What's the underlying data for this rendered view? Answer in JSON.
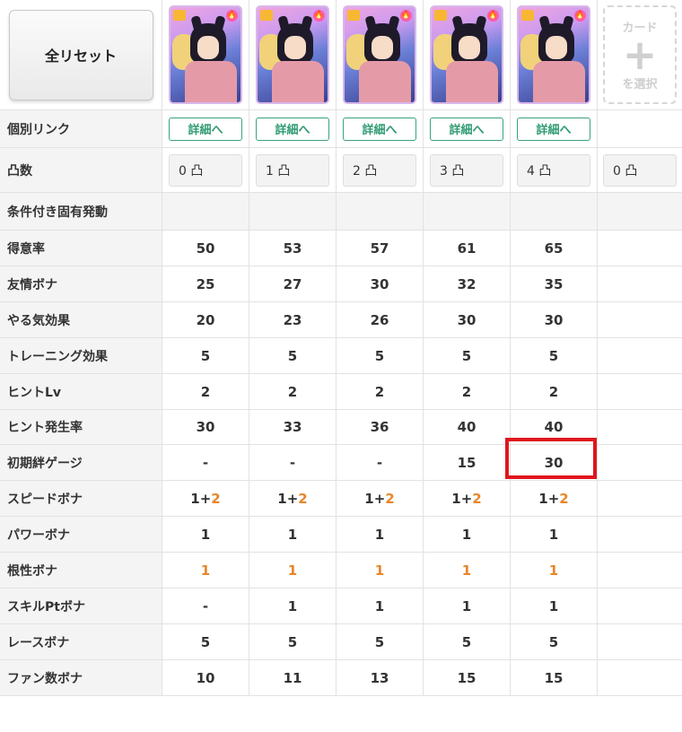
{
  "reset_button": "全リセット",
  "add_card": {
    "line1": "カード",
    "plus": "+",
    "line2": "を選択"
  },
  "cards": [
    {
      "flame": "🔥"
    },
    {
      "flame": "🔥"
    },
    {
      "flame": "🔥"
    },
    {
      "flame": "🔥"
    },
    {
      "flame": "🔥"
    }
  ],
  "rows": {
    "link": {
      "label": "個別リンク",
      "buttons": [
        "詳細へ",
        "詳細へ",
        "詳細へ",
        "詳細へ",
        "詳細へ"
      ]
    },
    "totsu": {
      "label": "凸数",
      "values": [
        "0 凸",
        "1 凸",
        "2 凸",
        "3 凸",
        "4 凸",
        "0 凸"
      ]
    },
    "conditional": {
      "label": "条件付き固有発動"
    },
    "tokui": {
      "label": "得意率",
      "values": [
        "50",
        "53",
        "57",
        "61",
        "65"
      ]
    },
    "yujo": {
      "label": "友情ボナ",
      "values": [
        "25",
        "27",
        "30",
        "32",
        "35"
      ]
    },
    "yaruki": {
      "label": "やる気効果",
      "values": [
        "20",
        "23",
        "26",
        "30",
        "30"
      ]
    },
    "training": {
      "label": "トレーニング効果",
      "values": [
        "5",
        "5",
        "5",
        "5",
        "5"
      ]
    },
    "hintlv": {
      "label": "ヒントLv",
      "values": [
        "2",
        "2",
        "2",
        "2",
        "2"
      ]
    },
    "hintrate": {
      "label": "ヒント発生率",
      "values": [
        "30",
        "33",
        "36",
        "40",
        "40"
      ]
    },
    "kizuna": {
      "label": "初期絆ゲージ",
      "values": [
        "-",
        "-",
        "-",
        "15",
        "30"
      ]
    },
    "speed": {
      "label": "スピードボナ",
      "base": [
        "1+",
        "1+",
        "1+",
        "1+",
        "1+"
      ],
      "bonus": [
        "2",
        "2",
        "2",
        "2",
        "2"
      ]
    },
    "power": {
      "label": "パワーボナ",
      "values": [
        "1",
        "1",
        "1",
        "1",
        "1"
      ]
    },
    "konjo": {
      "label": "根性ボナ",
      "values": [
        "1",
        "1",
        "1",
        "1",
        "1"
      ]
    },
    "skillpt": {
      "label": "スキルPtボナ",
      "values": [
        "-",
        "1",
        "1",
        "1",
        "1"
      ]
    },
    "race": {
      "label": "レースボナ",
      "values": [
        "5",
        "5",
        "5",
        "5",
        "5"
      ]
    },
    "fan": {
      "label": "ファン数ボナ",
      "values": [
        "10",
        "11",
        "13",
        "15",
        "15"
      ]
    }
  },
  "colors": {
    "accent_green": "#2f9b72",
    "orange": "#e8862a",
    "highlight_red": "#e0151d"
  }
}
